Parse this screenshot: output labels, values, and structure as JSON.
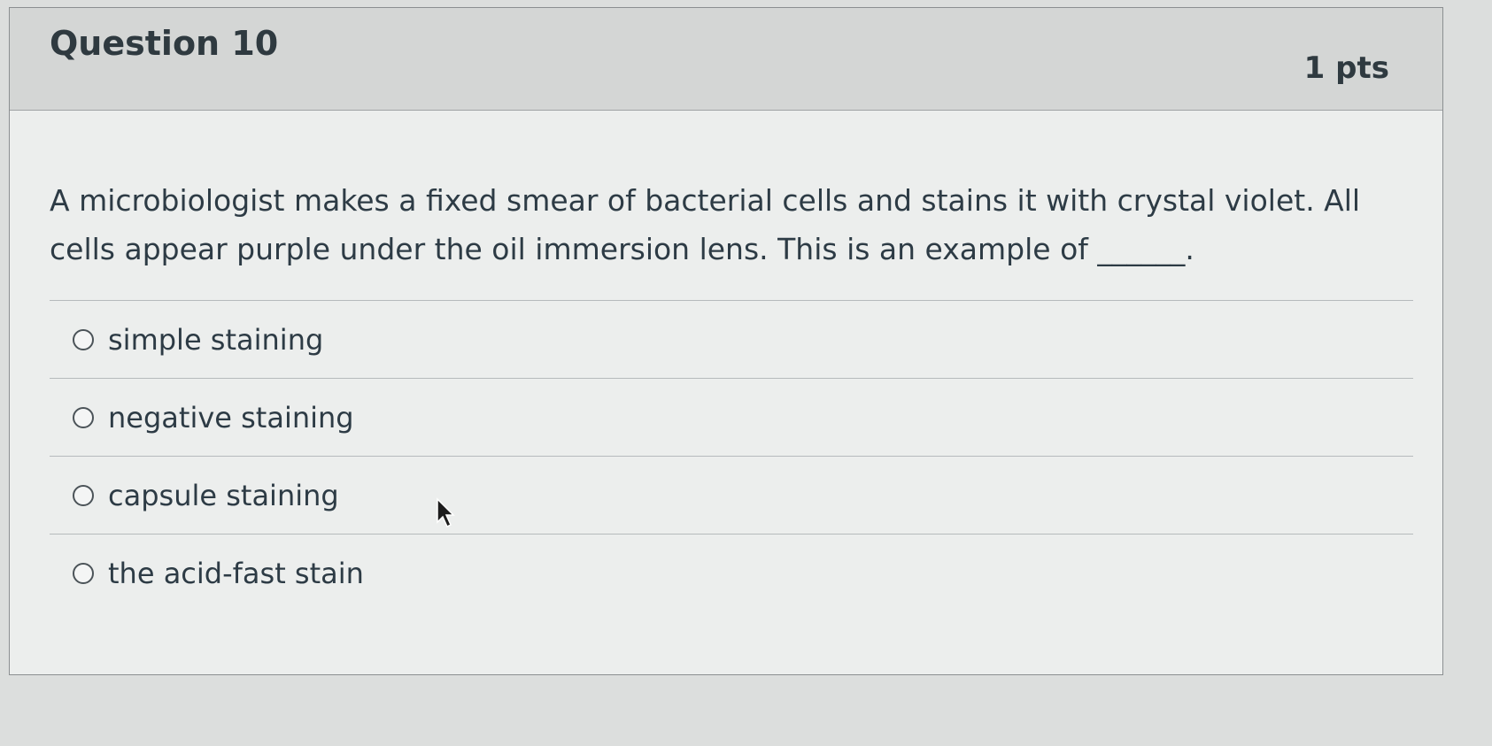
{
  "question": {
    "title": "Question 10",
    "points": "1 pts",
    "text": "A microbiologist makes a fixed smear of bacterial cells and stains it with crystal violet. All cells appear purple under the oil immersion lens. This is an example of ______."
  },
  "answers": [
    {
      "label": "simple staining",
      "selected": false
    },
    {
      "label": "negative staining",
      "selected": false
    },
    {
      "label": "capsule staining",
      "selected": false
    },
    {
      "label": "the acid-fast stain",
      "selected": false
    }
  ],
  "icons": {
    "radio": "radio-unchecked-icon",
    "cursor": "mouse-pointer-icon"
  }
}
